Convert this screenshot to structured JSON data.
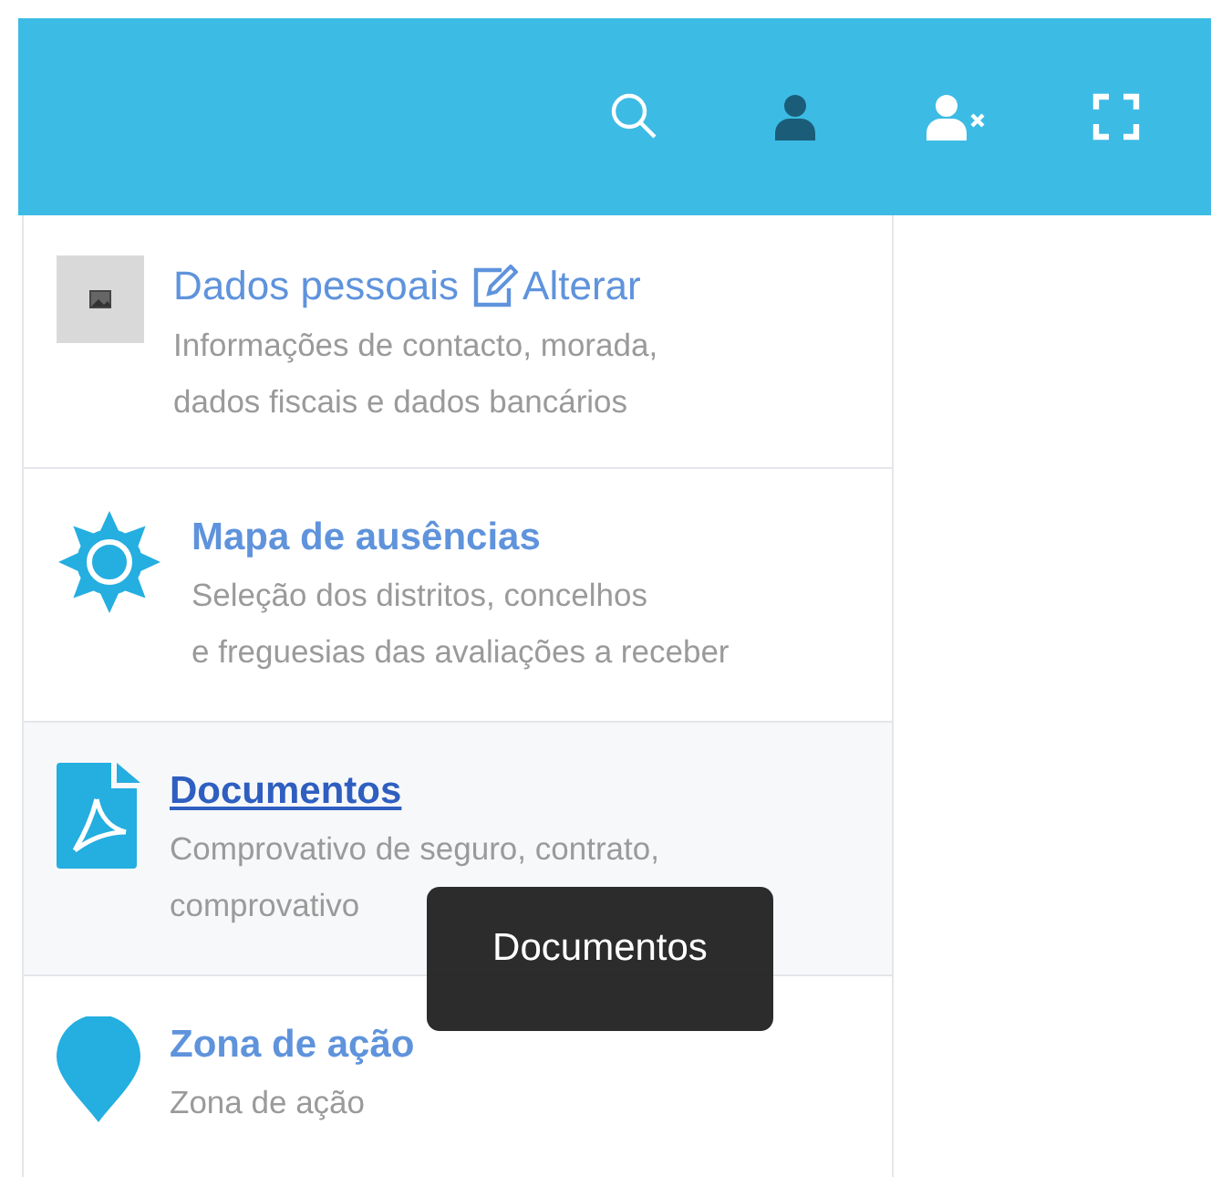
{
  "header": {
    "buttons": [
      {
        "kind": "search",
        "active": false
      },
      {
        "kind": "user",
        "active": true
      },
      {
        "kind": "user-remove",
        "active": false
      },
      {
        "kind": "fullscreen",
        "active": false
      }
    ]
  },
  "menu": {
    "items": [
      {
        "kind": "image",
        "title": "Dados pessoais",
        "edit_link": "Alterar",
        "description": [
          "Informações de contacto, morada,",
          "dados fiscais e dados bancários"
        ],
        "hovered": false
      },
      {
        "kind": "gear",
        "title": "Mapa de ausências",
        "description": [
          "Seleção dos distritos, concelhos",
          "e freguesias das avaliações a receber"
        ],
        "hovered": false
      },
      {
        "kind": "pdf",
        "title": "Documentos",
        "description": [
          "Comprovativo de seguro, contrato,",
          "comprovativo"
        ],
        "hovered": true
      },
      {
        "kind": "pin",
        "title": "Zona de ação",
        "description": [
          "Zona de ação"
        ],
        "hovered": false
      }
    ]
  },
  "tooltip": {
    "text": "Documentos"
  }
}
